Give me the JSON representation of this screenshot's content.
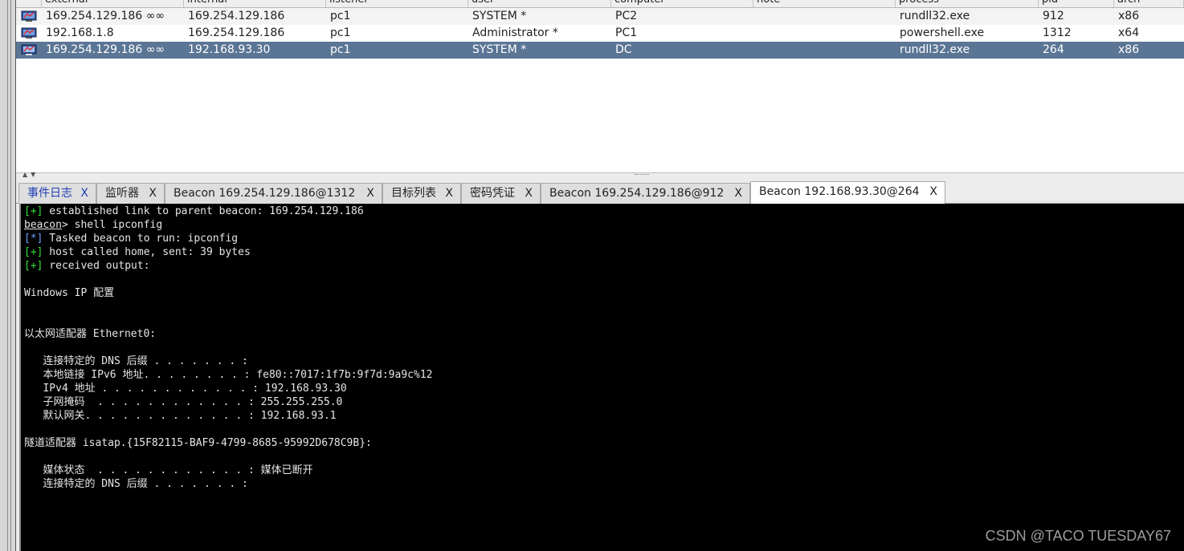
{
  "sessions_table": {
    "columns": [
      "external",
      "internal ^",
      "listener",
      "user",
      "computer",
      "note",
      "process",
      "pid",
      "arch"
    ],
    "rows": [
      {
        "external": "169.254.129.186 ∞∞",
        "internal": "169.254.129.186",
        "listener": "pc1",
        "user": "SYSTEM *",
        "computer": "PC2",
        "note": "",
        "process": "rundll32.exe",
        "pid": "912",
        "arch": "x86",
        "icon": "beacon-session-icon"
      },
      {
        "external": "192.168.1.8",
        "internal": "169.254.129.186",
        "listener": "pc1",
        "user": "Administrator *",
        "computer": "PC1",
        "note": "",
        "process": "powershell.exe",
        "pid": "1312",
        "arch": "x64",
        "icon": "beacon-session-icon"
      },
      {
        "external": "169.254.129.186 ∞∞",
        "internal": "192.168.93.30",
        "listener": "pc1",
        "user": "SYSTEM *",
        "computer": "DC",
        "note": "",
        "process": "rundll32.exe",
        "pid": "264",
        "arch": "x86",
        "icon": "beacon-session-icon",
        "selected": true
      }
    ]
  },
  "tabs": [
    {
      "label": "事件日志",
      "close": "X"
    },
    {
      "label": "监听器",
      "close": "X"
    },
    {
      "label": "Beacon 169.254.129.186@1312",
      "close": "X"
    },
    {
      "label": "目标列表",
      "close": "X"
    },
    {
      "label": "密码凭证",
      "close": "X"
    },
    {
      "label": "Beacon 169.254.129.186@912",
      "close": "X"
    },
    {
      "label": "Beacon 192.168.93.30@264",
      "close": "X",
      "active": true
    }
  ],
  "console": {
    "lines": [
      {
        "prefix": "[+]",
        "text": " established link to parent beacon: 169.254.129.186"
      },
      {
        "prompt": "beacon",
        "text": "> shell ipconfig"
      },
      {
        "prefix": "[*]",
        "text": " Tasked beacon to run: ipconfig"
      },
      {
        "prefix": "[+]",
        "text": " host called home, sent: 39 bytes"
      },
      {
        "prefix": "[+]",
        "text": " received output:"
      },
      {
        "text": ""
      },
      {
        "text": "Windows IP 配置"
      },
      {
        "text": ""
      },
      {
        "text": ""
      },
      {
        "text": "以太网适配器 Ethernet0:"
      },
      {
        "text": ""
      },
      {
        "text": "   连接特定的 DNS 后缀 . . . . . . . :"
      },
      {
        "text": "   本地链接 IPv6 地址. . . . . . . . : fe80::7017:1f7b:9f7d:9a9c%12"
      },
      {
        "text": "   IPv4 地址 . . . . . . . . . . . . : 192.168.93.30"
      },
      {
        "text": "   子网掩码  . . . . . . . . . . . . : 255.255.255.0"
      },
      {
        "text": "   默认网关. . . . . . . . . . . . . : 192.168.93.1"
      },
      {
        "text": ""
      },
      {
        "text": "隧道适配器 isatap.{15F82115-BAF9-4799-8685-95992D678C9B}:"
      },
      {
        "text": ""
      },
      {
        "text": "   媒体状态  . . . . . . . . . . . . : 媒体已断开"
      },
      {
        "text": "   连接特定的 DNS 后缀 . . . . . . . :"
      }
    ]
  },
  "watermark": "CSDN @TACO TUESDAY67",
  "colors": {
    "selected_row": "#5b7595",
    "console_bg": "#000000",
    "plus": "#35e035",
    "star": "#6aa0ff"
  }
}
